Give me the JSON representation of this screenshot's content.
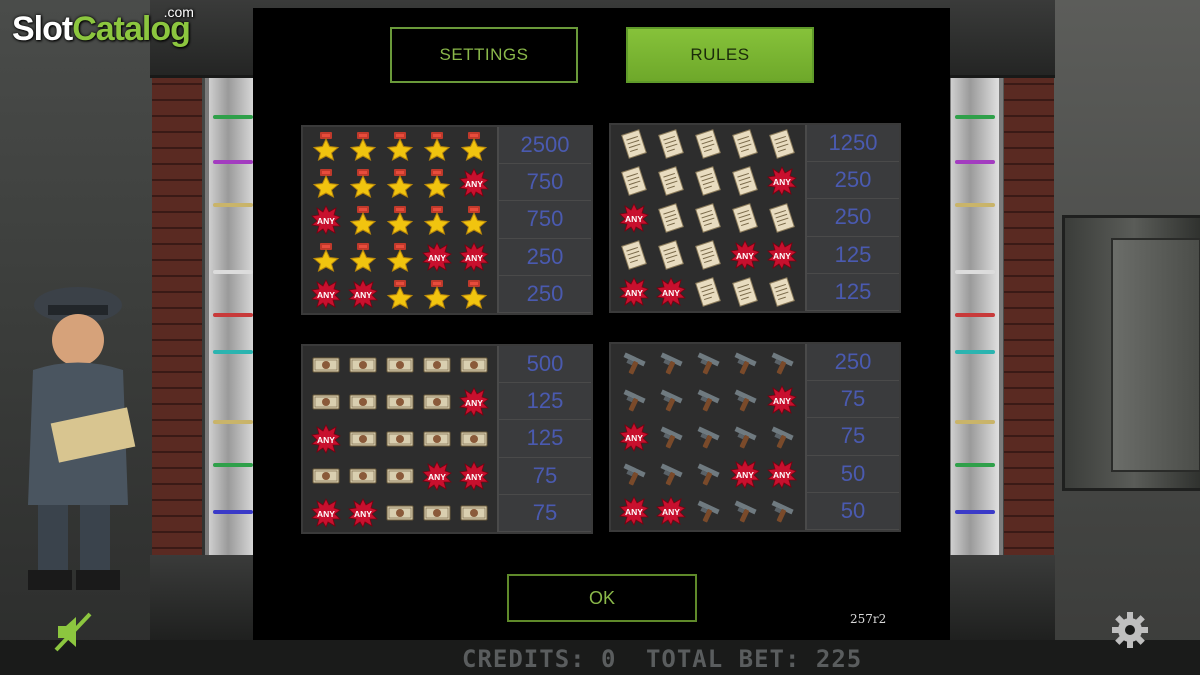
{
  "logo": {
    "part1": "Slot",
    "part2": "Catalog",
    "tld": ".com"
  },
  "tabs": {
    "settings": "SETTINGS",
    "rules": "RULES"
  },
  "paytables": [
    {
      "symbol": "medal-icon",
      "rows": [
        {
          "pattern": [
            "S",
            "S",
            "S",
            "S",
            "S"
          ],
          "value": "2500"
        },
        {
          "pattern": [
            "S",
            "S",
            "S",
            "S",
            "A"
          ],
          "value": "750"
        },
        {
          "pattern": [
            "A",
            "S",
            "S",
            "S",
            "S"
          ],
          "value": "750"
        },
        {
          "pattern": [
            "S",
            "S",
            "S",
            "A",
            "A"
          ],
          "value": "250"
        },
        {
          "pattern": [
            "A",
            "A",
            "S",
            "S",
            "S"
          ],
          "value": "250"
        }
      ]
    },
    {
      "symbol": "document-icon",
      "rows": [
        {
          "pattern": [
            "S",
            "S",
            "S",
            "S",
            "S"
          ],
          "value": "1250"
        },
        {
          "pattern": [
            "S",
            "S",
            "S",
            "S",
            "A"
          ],
          "value": "250"
        },
        {
          "pattern": [
            "A",
            "S",
            "S",
            "S",
            "S"
          ],
          "value": "250"
        },
        {
          "pattern": [
            "S",
            "S",
            "S",
            "A",
            "A"
          ],
          "value": "125"
        },
        {
          "pattern": [
            "A",
            "A",
            "S",
            "S",
            "S"
          ],
          "value": "125"
        }
      ]
    },
    {
      "symbol": "banknote-icon",
      "rows": [
        {
          "pattern": [
            "S",
            "S",
            "S",
            "S",
            "S"
          ],
          "value": "500"
        },
        {
          "pattern": [
            "S",
            "S",
            "S",
            "S",
            "A"
          ],
          "value": "125"
        },
        {
          "pattern": [
            "A",
            "S",
            "S",
            "S",
            "S"
          ],
          "value": "125"
        },
        {
          "pattern": [
            "S",
            "S",
            "S",
            "A",
            "A"
          ],
          "value": "75"
        },
        {
          "pattern": [
            "A",
            "A",
            "S",
            "S",
            "S"
          ],
          "value": "75"
        }
      ]
    },
    {
      "symbol": "pistol-icon",
      "rows": [
        {
          "pattern": [
            "S",
            "S",
            "S",
            "S",
            "S"
          ],
          "value": "250"
        },
        {
          "pattern": [
            "S",
            "S",
            "S",
            "S",
            "A"
          ],
          "value": "75"
        },
        {
          "pattern": [
            "A",
            "S",
            "S",
            "S",
            "S"
          ],
          "value": "75"
        },
        {
          "pattern": [
            "S",
            "S",
            "S",
            "A",
            "A"
          ],
          "value": "50"
        },
        {
          "pattern": [
            "A",
            "A",
            "S",
            "S",
            "S"
          ],
          "value": "50"
        }
      ]
    }
  ],
  "any_label": "ANY",
  "ok_label": "OK",
  "version": "257r2",
  "footer": {
    "credits": "Credits: 0",
    "total_bet": "Total Bet: 225"
  },
  "colors": {
    "accent": "#86c23a",
    "value_text": "#4a5ab0",
    "any_burst": "#c8102e"
  }
}
